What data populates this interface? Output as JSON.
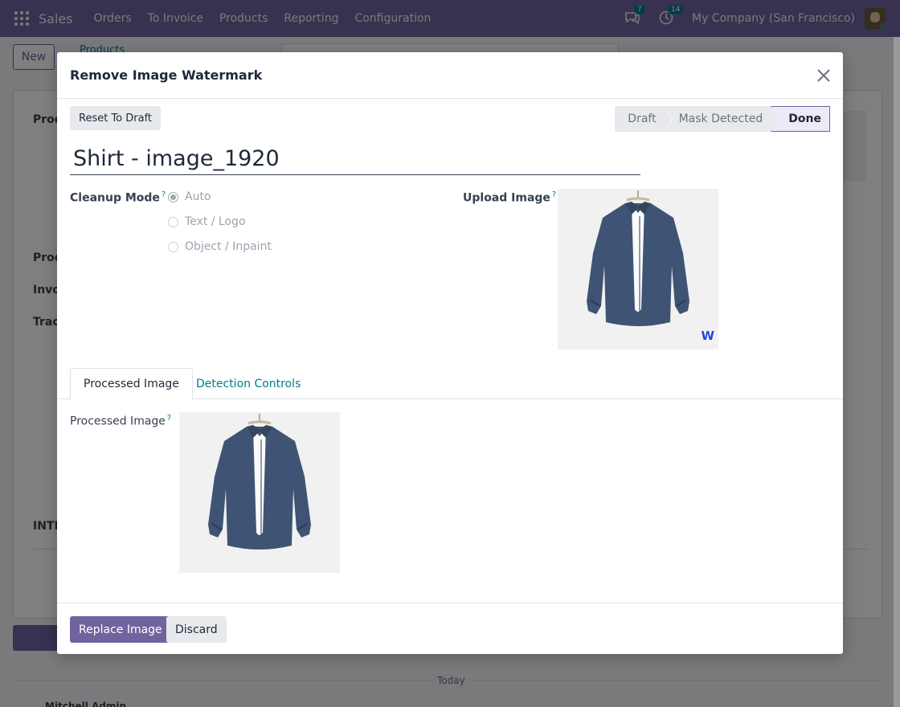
{
  "navbar": {
    "brand": "Sales",
    "menu": [
      "Orders",
      "To Invoice",
      "Products",
      "Reporting",
      "Configuration"
    ],
    "messages_count": "7",
    "activities_count": "14",
    "company": "My Company (San Francisco)",
    "icons": [
      "apps-grid-icon",
      "chat-icon",
      "clock-icon",
      "user-avatar"
    ]
  },
  "background": {
    "new_button": "New",
    "breadcrumb": "Products",
    "today_label": "Today",
    "chatter_author": "Mitchell Admin"
  },
  "modal": {
    "title": "Remove Image Watermark",
    "reset_button": "Reset To Draft",
    "stages": [
      {
        "label": "Draft",
        "active": false
      },
      {
        "label": "Mask Detected",
        "active": false
      },
      {
        "label": "Done",
        "active": true
      }
    ],
    "record_name": "Shirt - image_1920",
    "cleanup_mode": {
      "label": "Cleanup Mode",
      "help": "?",
      "options": [
        {
          "label": "Auto",
          "selected": true
        },
        {
          "label": "Text / Logo",
          "selected": false
        },
        {
          "label": "Object / Inpaint",
          "selected": false
        }
      ]
    },
    "upload_image": {
      "label": "Upload Image",
      "help": "?",
      "watermark_text": "W"
    },
    "tabs": [
      {
        "label": "Processed Image",
        "active": true
      },
      {
        "label": "Detection Controls",
        "active": false
      }
    ],
    "processed_image": {
      "label": "Processed Image",
      "help": "?"
    },
    "footer": {
      "primary": "Replace Image",
      "secondary": "Discard"
    }
  },
  "colors": {
    "brand_purple": "#71639e",
    "link_teal": "#017e84",
    "watermark_blue": "#2446e8"
  }
}
